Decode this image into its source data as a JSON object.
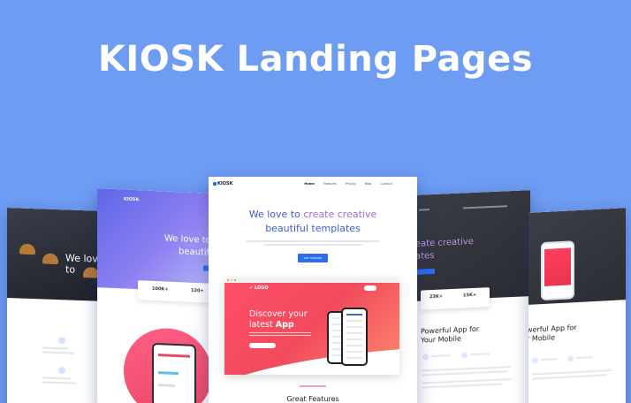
{
  "headline": "KIOSK Landing Pages",
  "colors": {
    "background": "#6e9cf3",
    "accent_blue": "#2d6cf0",
    "accent_pink": "#f24a5d"
  },
  "previews": {
    "far_left": {
      "hero_text": "We love to"
    },
    "left": {
      "brand": "KIOSK",
      "hero_line1": "We love to cr",
      "hero_line2": "beautiful",
      "stat_1": "100K+",
      "stat_2": "120+"
    },
    "center": {
      "logo": "KIOSK",
      "nav": [
        "Home",
        "Features",
        "Pricing",
        "Blog",
        "Contact"
      ],
      "headline_part1": "We love to ",
      "headline_highlight": "create creative",
      "headline_line2": "beautiful templates",
      "cta": "GET STARTED",
      "mockup": {
        "logo": "LOGO",
        "title_line1": "Discover your",
        "title_line2_prefix": "latest ",
        "title_line2_bold": "App",
        "cta": "GET STARTED"
      },
      "section_title": "Great Features"
    },
    "right": {
      "hero_line1": "reate creative",
      "hero_line2": "ates",
      "stat_1": "23K+",
      "stat_2": "15K+",
      "title_line1": "Powerful App for",
      "title_line2": "Your Mobile"
    },
    "far_right": {
      "title_line1": "werful App for",
      "title_line2": "r Mobile"
    }
  }
}
